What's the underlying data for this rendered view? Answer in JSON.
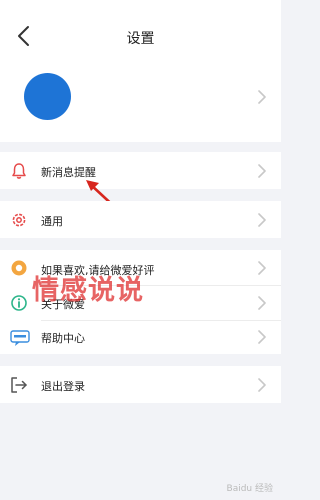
{
  "header": {
    "title": "设置",
    "back_icon": "chevron-left-icon"
  },
  "profile": {
    "avatar_color": "#1e74d6"
  },
  "groups": [
    {
      "items": [
        {
          "label": "新消息提醒",
          "icon": "bell-icon"
        }
      ]
    },
    {
      "items": [
        {
          "label": "通用",
          "icon": "gear-icon"
        }
      ]
    },
    {
      "items": [
        {
          "label": "如果喜欢,请给微爱好评",
          "icon": "star-badge-icon"
        },
        {
          "label": "关于微爱",
          "icon": "info-icon"
        },
        {
          "label": "帮助中心",
          "icon": "help-icon"
        }
      ]
    },
    {
      "items": [
        {
          "label": "退出登录",
          "icon": "logout-icon"
        }
      ]
    }
  ],
  "overlay": {
    "watermark": "情感说说",
    "baidu": "Baidu 经验"
  },
  "colors": {
    "accent_red": "#e64a4a",
    "chevron": "#c8c8c8",
    "bg": "#f2f3f7"
  }
}
